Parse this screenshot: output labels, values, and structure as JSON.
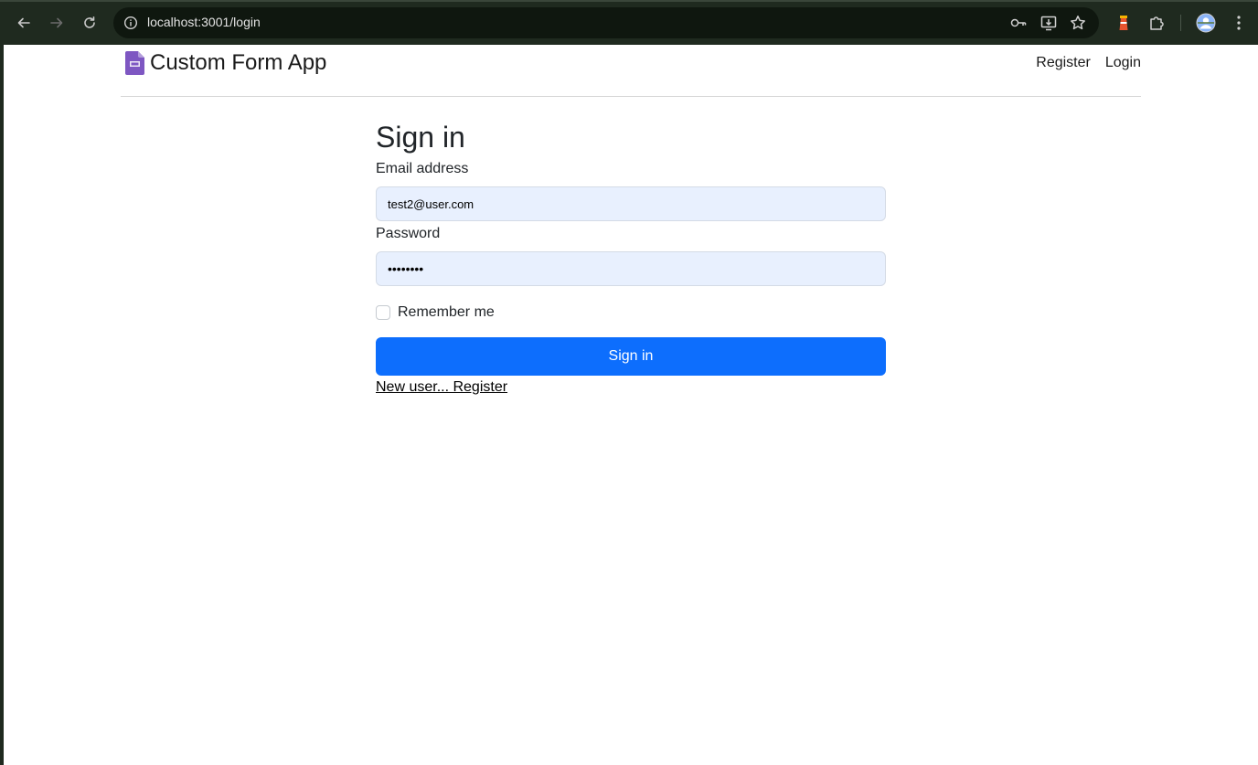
{
  "browser": {
    "url": "localhost:3001/login",
    "icons": [
      "back-arrow-icon",
      "forward-arrow-icon",
      "reload-icon",
      "site-info-icon",
      "key-icon",
      "install-app-icon",
      "star-icon",
      "extension-puzzle-icon",
      "profile-avatar-icon",
      "more-vert-icon"
    ]
  },
  "header": {
    "brand": "Custom Form App",
    "nav": {
      "register": "Register",
      "login": "Login"
    }
  },
  "form": {
    "title": "Sign in",
    "email_label": "Email address",
    "email_value": "test2@user.com",
    "password_label": "Password",
    "password_value": "••••••••",
    "remember_label": "Remember me",
    "remember_checked": false,
    "submit_label": "Sign in",
    "register_link": "New user... Register"
  },
  "colors": {
    "primary": "#0d6efd",
    "input_autofill_bg": "#e8f0fe",
    "brand_icon": "#7e57c2",
    "chrome_bg": "#1f2a1f"
  }
}
